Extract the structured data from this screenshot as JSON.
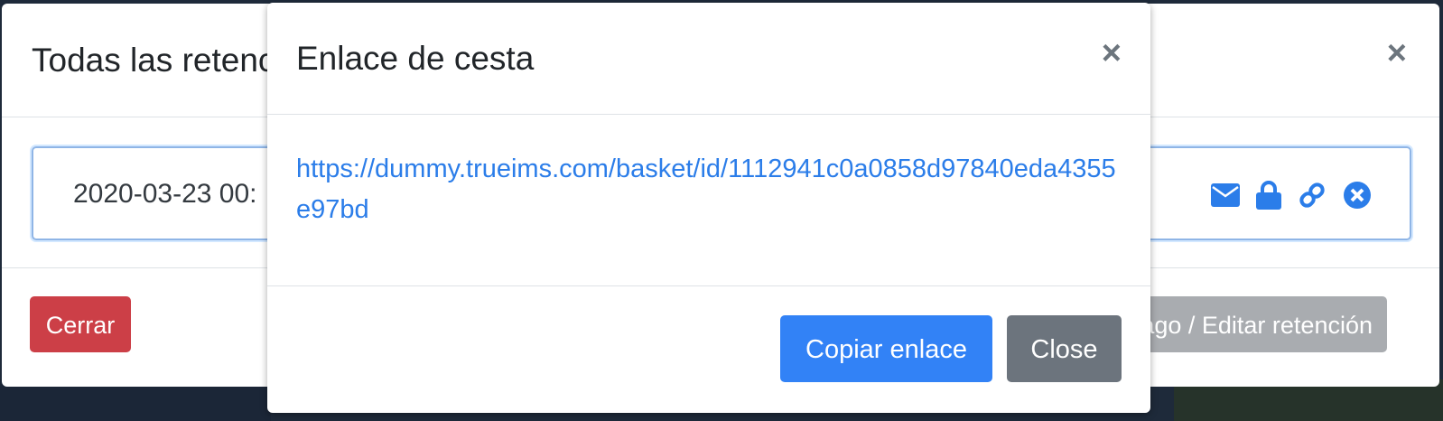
{
  "colors": {
    "primary": "#3282f6",
    "danger": "#cc3f47",
    "secondary": "#6c747d",
    "link": "#2b7de9"
  },
  "back_modal": {
    "title": "Todas las retenciones",
    "close_glyph": "×",
    "item": {
      "date_text": "2020-03-23 00:",
      "icons": [
        "envelope-icon",
        "lock-icon",
        "link-icon",
        "times-circle-icon"
      ]
    },
    "footer": {
      "close_label": "Cerrar",
      "edit_label": "Ir a pago / Editar retención"
    }
  },
  "front_modal": {
    "title": "Enlace de cesta",
    "close_glyph": "×",
    "link": "https://dummy.trueims.com/basket/id/1112941c0a0858d97840eda4355e97bd",
    "copy_label": "Copiar enlace",
    "close_label": "Close"
  }
}
